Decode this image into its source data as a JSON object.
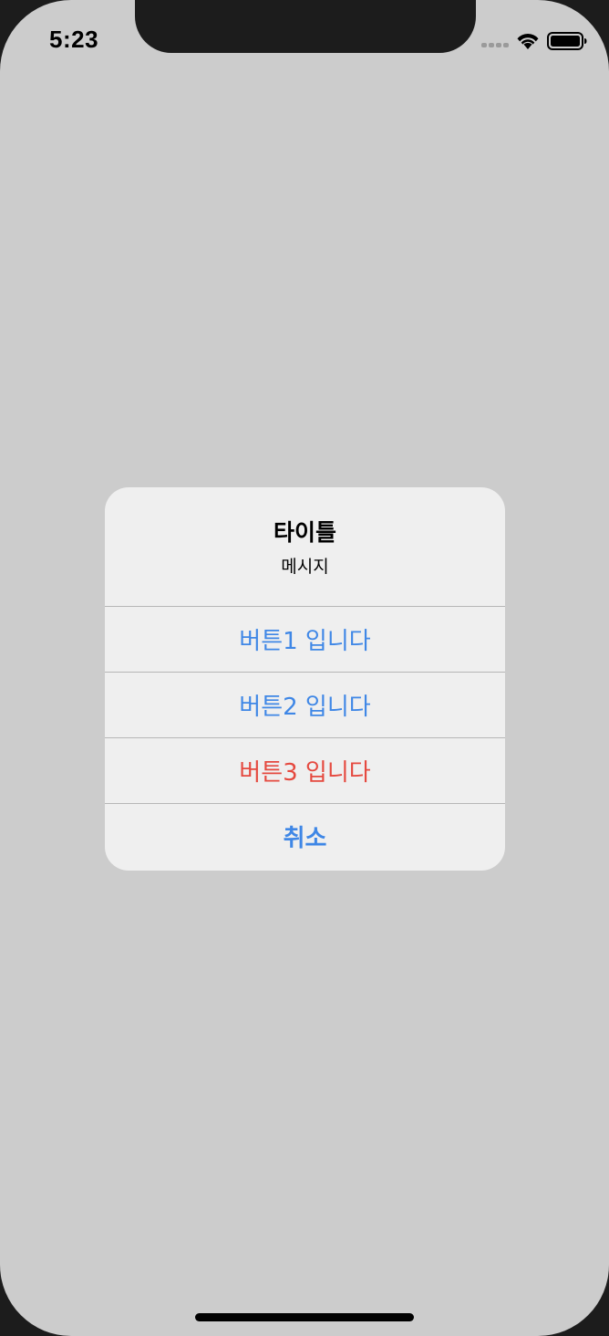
{
  "status_bar": {
    "time": "5:23"
  },
  "alert": {
    "title": "타이틀",
    "message": "메시지",
    "actions": [
      {
        "label": "버튼1 입니다",
        "style": "default"
      },
      {
        "label": "버튼2 입니다",
        "style": "default"
      },
      {
        "label": "버튼3 입니다",
        "style": "destructive"
      },
      {
        "label": "취소",
        "style": "cancel"
      }
    ]
  },
  "colors": {
    "action_blue": "#3f87e6",
    "destructive_red": "#e5493f",
    "dimmed_background": "#cccccc",
    "alert_background": "#efefef"
  }
}
